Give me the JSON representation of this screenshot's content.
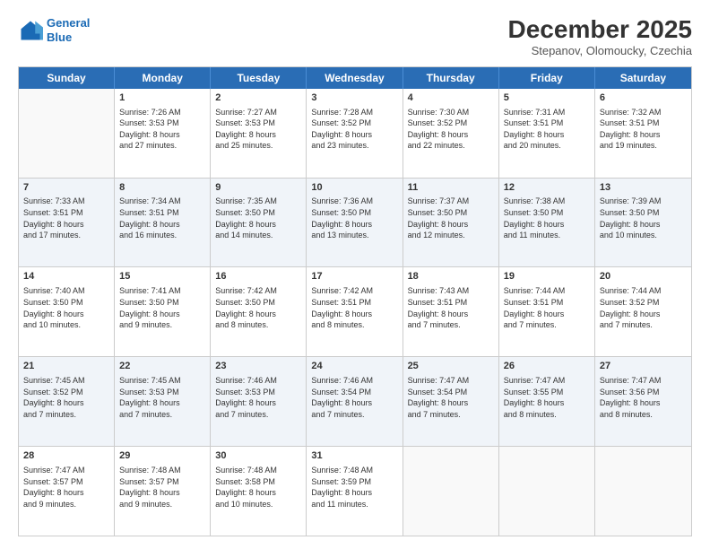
{
  "logo": {
    "line1": "General",
    "line2": "Blue"
  },
  "title": "December 2025",
  "subtitle": "Stepanov, Olomoucky, Czechia",
  "header_days": [
    "Sunday",
    "Monday",
    "Tuesday",
    "Wednesday",
    "Thursday",
    "Friday",
    "Saturday"
  ],
  "rows": [
    [
      {
        "day": "",
        "empty": true
      },
      {
        "day": "1",
        "info": "Sunrise: 7:26 AM\nSunset: 3:53 PM\nDaylight: 8 hours\nand 27 minutes."
      },
      {
        "day": "2",
        "info": "Sunrise: 7:27 AM\nSunset: 3:53 PM\nDaylight: 8 hours\nand 25 minutes."
      },
      {
        "day": "3",
        "info": "Sunrise: 7:28 AM\nSunset: 3:52 PM\nDaylight: 8 hours\nand 23 minutes."
      },
      {
        "day": "4",
        "info": "Sunrise: 7:30 AM\nSunset: 3:52 PM\nDaylight: 8 hours\nand 22 minutes."
      },
      {
        "day": "5",
        "info": "Sunrise: 7:31 AM\nSunset: 3:51 PM\nDaylight: 8 hours\nand 20 minutes."
      },
      {
        "day": "6",
        "info": "Sunrise: 7:32 AM\nSunset: 3:51 PM\nDaylight: 8 hours\nand 19 minutes."
      }
    ],
    [
      {
        "day": "7",
        "info": "Sunrise: 7:33 AM\nSunset: 3:51 PM\nDaylight: 8 hours\nand 17 minutes."
      },
      {
        "day": "8",
        "info": "Sunrise: 7:34 AM\nSunset: 3:51 PM\nDaylight: 8 hours\nand 16 minutes."
      },
      {
        "day": "9",
        "info": "Sunrise: 7:35 AM\nSunset: 3:50 PM\nDaylight: 8 hours\nand 14 minutes."
      },
      {
        "day": "10",
        "info": "Sunrise: 7:36 AM\nSunset: 3:50 PM\nDaylight: 8 hours\nand 13 minutes."
      },
      {
        "day": "11",
        "info": "Sunrise: 7:37 AM\nSunset: 3:50 PM\nDaylight: 8 hours\nand 12 minutes."
      },
      {
        "day": "12",
        "info": "Sunrise: 7:38 AM\nSunset: 3:50 PM\nDaylight: 8 hours\nand 11 minutes."
      },
      {
        "day": "13",
        "info": "Sunrise: 7:39 AM\nSunset: 3:50 PM\nDaylight: 8 hours\nand 10 minutes."
      }
    ],
    [
      {
        "day": "14",
        "info": "Sunrise: 7:40 AM\nSunset: 3:50 PM\nDaylight: 8 hours\nand 10 minutes."
      },
      {
        "day": "15",
        "info": "Sunrise: 7:41 AM\nSunset: 3:50 PM\nDaylight: 8 hours\nand 9 minutes."
      },
      {
        "day": "16",
        "info": "Sunrise: 7:42 AM\nSunset: 3:50 PM\nDaylight: 8 hours\nand 8 minutes."
      },
      {
        "day": "17",
        "info": "Sunrise: 7:42 AM\nSunset: 3:51 PM\nDaylight: 8 hours\nand 8 minutes."
      },
      {
        "day": "18",
        "info": "Sunrise: 7:43 AM\nSunset: 3:51 PM\nDaylight: 8 hours\nand 7 minutes."
      },
      {
        "day": "19",
        "info": "Sunrise: 7:44 AM\nSunset: 3:51 PM\nDaylight: 8 hours\nand 7 minutes."
      },
      {
        "day": "20",
        "info": "Sunrise: 7:44 AM\nSunset: 3:52 PM\nDaylight: 8 hours\nand 7 minutes."
      }
    ],
    [
      {
        "day": "21",
        "info": "Sunrise: 7:45 AM\nSunset: 3:52 PM\nDaylight: 8 hours\nand 7 minutes."
      },
      {
        "day": "22",
        "info": "Sunrise: 7:45 AM\nSunset: 3:53 PM\nDaylight: 8 hours\nand 7 minutes."
      },
      {
        "day": "23",
        "info": "Sunrise: 7:46 AM\nSunset: 3:53 PM\nDaylight: 8 hours\nand 7 minutes."
      },
      {
        "day": "24",
        "info": "Sunrise: 7:46 AM\nSunset: 3:54 PM\nDaylight: 8 hours\nand 7 minutes."
      },
      {
        "day": "25",
        "info": "Sunrise: 7:47 AM\nSunset: 3:54 PM\nDaylight: 8 hours\nand 7 minutes."
      },
      {
        "day": "26",
        "info": "Sunrise: 7:47 AM\nSunset: 3:55 PM\nDaylight: 8 hours\nand 8 minutes."
      },
      {
        "day": "27",
        "info": "Sunrise: 7:47 AM\nSunset: 3:56 PM\nDaylight: 8 hours\nand 8 minutes."
      }
    ],
    [
      {
        "day": "28",
        "info": "Sunrise: 7:47 AM\nSunset: 3:57 PM\nDaylight: 8 hours\nand 9 minutes."
      },
      {
        "day": "29",
        "info": "Sunrise: 7:48 AM\nSunset: 3:57 PM\nDaylight: 8 hours\nand 9 minutes."
      },
      {
        "day": "30",
        "info": "Sunrise: 7:48 AM\nSunset: 3:58 PM\nDaylight: 8 hours\nand 10 minutes."
      },
      {
        "day": "31",
        "info": "Sunrise: 7:48 AM\nSunset: 3:59 PM\nDaylight: 8 hours\nand 11 minutes."
      },
      {
        "day": "",
        "empty": true
      },
      {
        "day": "",
        "empty": true
      },
      {
        "day": "",
        "empty": true
      }
    ]
  ]
}
